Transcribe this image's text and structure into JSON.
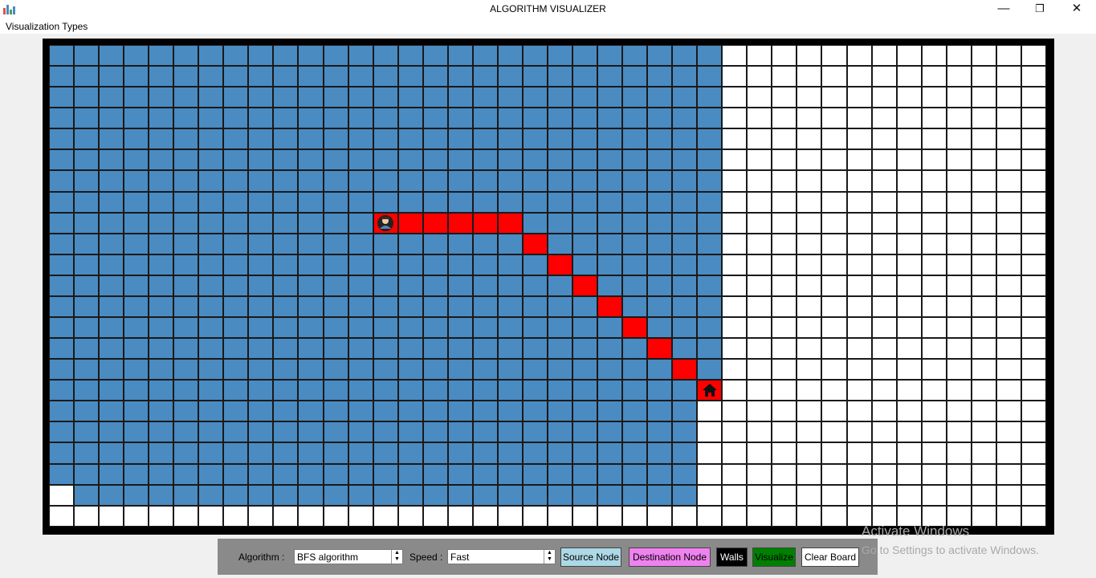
{
  "window": {
    "title": "ALGORITHM VISUALIZER",
    "minimize_glyph": "—",
    "maximize_glyph": "❐",
    "close_glyph": "✕"
  },
  "menu": {
    "items": [
      {
        "label": "Visualization Types"
      }
    ]
  },
  "board": {
    "columns": 40,
    "rows": 23,
    "colors": {
      "empty": "#ffffff",
      "visited": "#4a8bc2",
      "path": "#ff0000",
      "border": "#000000"
    },
    "source": {
      "row": 8,
      "col": 13,
      "icon": "person-icon"
    },
    "destination": {
      "row": 16,
      "col": 26,
      "icon": "home-icon"
    },
    "path": [
      [
        8,
        14
      ],
      [
        8,
        15
      ],
      [
        8,
        16
      ],
      [
        8,
        17
      ],
      [
        8,
        18
      ],
      [
        9,
        19
      ],
      [
        10,
        20
      ],
      [
        11,
        21
      ],
      [
        12,
        22
      ],
      [
        13,
        23
      ],
      [
        14,
        24
      ],
      [
        15,
        25
      ]
    ],
    "visited_ranges": [
      {
        "rows": [
          0,
          16
        ],
        "col_start": 0,
        "col_end": 26
      },
      {
        "rows": [
          17,
          20
        ],
        "col_start": 0,
        "col_end": 25
      },
      {
        "rows": [
          21,
          21
        ],
        "col_start": 1,
        "col_end": 25
      }
    ]
  },
  "controls": {
    "algorithm_label": "Algorithm :",
    "algorithm_value": "BFS algorithm",
    "speed_label": "Speed :",
    "speed_value": "Fast",
    "buttons": {
      "source": {
        "label": "Source Node",
        "color": "#add8e6"
      },
      "destination": {
        "label": "Destination Node",
        "color": "#ee82ee"
      },
      "walls": {
        "label": "Walls",
        "color": "#000000",
        "text_color": "#ffffff"
      },
      "visualize": {
        "label": "Visualize",
        "color": "#008000",
        "text_color": "#000000"
      },
      "clear": {
        "label": "Clear Board",
        "color": "#ffffff"
      }
    }
  },
  "watermark": {
    "line1": "Activate Windows",
    "line2": "Go to Settings to activate Windows."
  }
}
